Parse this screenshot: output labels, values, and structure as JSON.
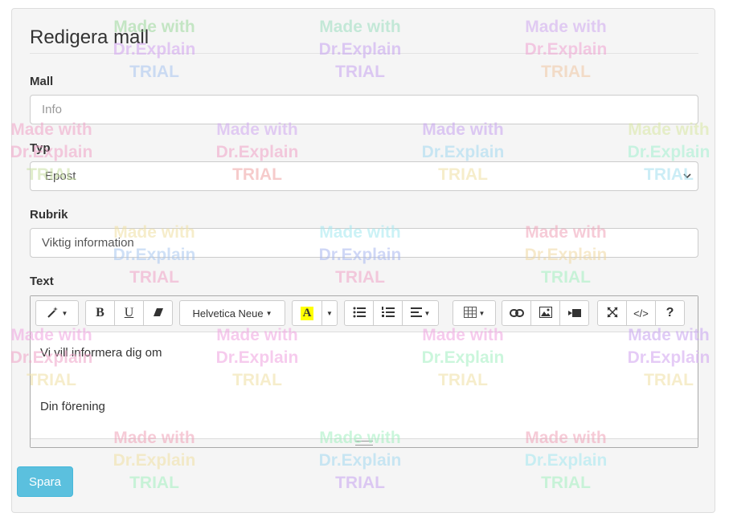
{
  "form": {
    "title": "Redigera mall",
    "template_label": "Mall",
    "template_placeholder": "Info",
    "type_label": "Typ",
    "type_value": "Epost",
    "subject_label": "Rubrik",
    "subject_value": "Viktig information",
    "text_label": "Text",
    "save_label": "Spara"
  },
  "editor": {
    "font_name": "Helvetica Neue",
    "content_lines": [
      "Vi vill informera dig om",
      "Din förening"
    ],
    "highlight_color": "#ffff00",
    "toolbar_icons": [
      "magic-wand-icon",
      "bold-icon",
      "underline-icon",
      "eraser-icon",
      "font-color-icon",
      "unordered-list-icon",
      "ordered-list-icon",
      "align-icon",
      "table-icon",
      "link-icon",
      "picture-icon",
      "video-icon",
      "fullscreen-icon",
      "code-view-icon",
      "help-icon"
    ]
  },
  "watermark": {
    "line1": "Made with",
    "line2": "Dr.Explain",
    "line3": "TRIAL"
  },
  "colors": {
    "accent": "#5bc0de",
    "panel_bg": "#f5f5f5"
  }
}
